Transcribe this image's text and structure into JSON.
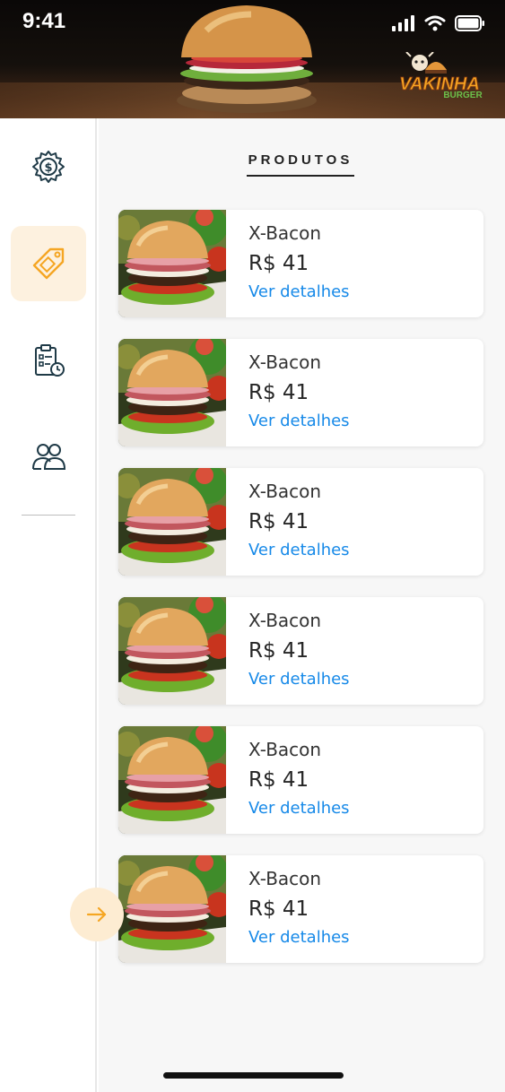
{
  "status_bar": {
    "time": "9:41"
  },
  "brand": {
    "logo_text_top": "VAKINHA",
    "logo_text_bottom": "BURGER",
    "accent": "#f5a623"
  },
  "colors": {
    "active_nav_bg": "#fdf1df",
    "link": "#1689e8",
    "next_button_bg": "#fdecd2"
  },
  "sidebar": {
    "items": [
      {
        "icon": "settings-dollar-icon",
        "active": false
      },
      {
        "icon": "price-tag-icon",
        "active": true
      },
      {
        "icon": "clipboard-clock-icon",
        "active": false
      },
      {
        "icon": "users-icon",
        "active": false
      }
    ],
    "next_icon": "arrow-right-icon"
  },
  "page": {
    "title": "PRODUTOS"
  },
  "products": [
    {
      "name": "X-Bacon",
      "price": "R$ 41",
      "link": "Ver detalhes"
    },
    {
      "name": "X-Bacon",
      "price": "R$ 41",
      "link": "Ver detalhes"
    },
    {
      "name": "X-Bacon",
      "price": "R$ 41",
      "link": "Ver detalhes"
    },
    {
      "name": "X-Bacon",
      "price": "R$ 41",
      "link": "Ver detalhes"
    },
    {
      "name": "X-Bacon",
      "price": "R$ 41",
      "link": "Ver detalhes"
    },
    {
      "name": "X-Bacon",
      "price": "R$ 41",
      "link": "Ver detalhes"
    }
  ]
}
